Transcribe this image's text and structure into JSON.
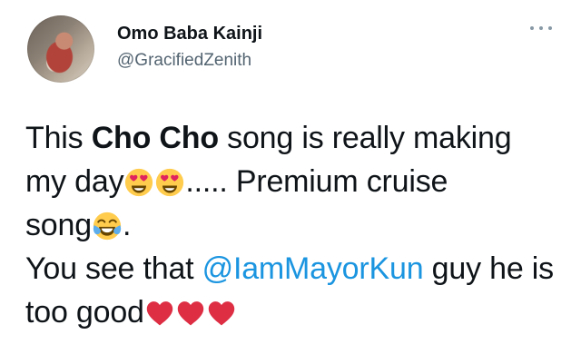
{
  "author": {
    "display_name": "Omo Baba Kainji",
    "handle": "@GracifiedZenith"
  },
  "tweet": {
    "line1": {
      "pre": "This ",
      "bold": "Cho Cho",
      "post": " song is really making"
    },
    "line2": {
      "pre": "my day",
      "post": "..... Premium cruise"
    },
    "line3": {
      "pre": "song",
      "post": "."
    },
    "line4": {
      "pre": "You see that ",
      "mention": "@IamMayorKun",
      "post": " guy he is"
    },
    "line5": {
      "pre": "too good"
    }
  },
  "emojis": {
    "heart_eyes": "heart-eyes-emoji",
    "tears_of_joy": "tears-of-joy-emoji",
    "red_heart": "red-heart-emoji"
  },
  "colors": {
    "mention": "#1b95e0",
    "handle": "#536471",
    "text": "#0f1419",
    "heart": "#e0245e",
    "emoji_face": "#ffcc4d"
  }
}
